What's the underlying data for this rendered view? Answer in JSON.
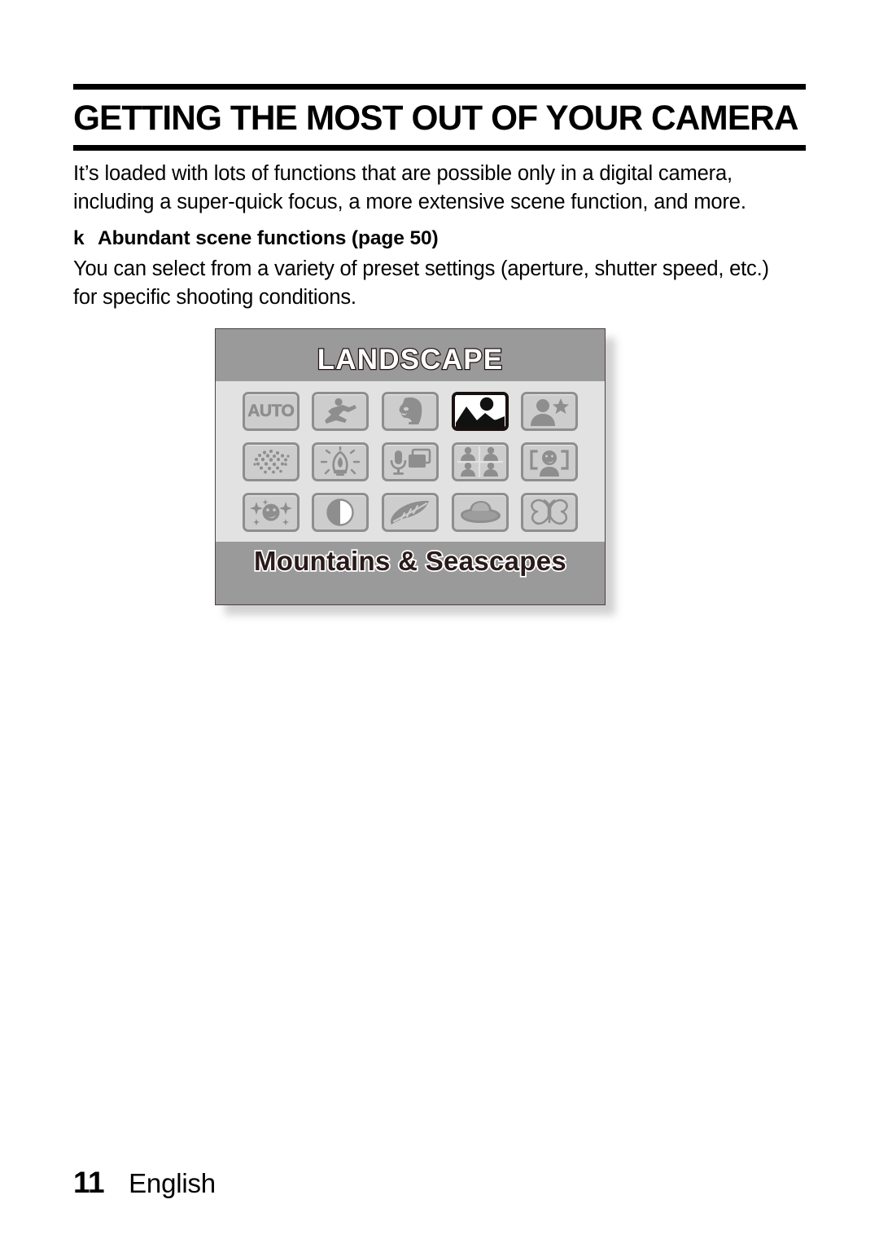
{
  "document": {
    "title": "GETTING THE MOST OUT OF YOUR CAMERA",
    "intro_line_1": "It’s loaded with lots of functions that are possible only in a digital camera,",
    "intro_line_2": "including a super-quick focus, a more extensive scene function, and more.",
    "subhead_bullet": "k",
    "subhead_text": "Abundant scene functions (page 50)",
    "subbody_line_1": "You can select from a variety of preset settings (aperture, shutter speed, etc.)",
    "subbody_line_2": "for specific shooting conditions."
  },
  "figure": {
    "lcd_title": "LANDSCAPE",
    "lcd_caption": "Mountains & Seascapes",
    "auto_label": "AUTO",
    "selected_index": 3,
    "tiles": [
      {
        "name": "auto-mode",
        "label": "AUTO"
      },
      {
        "name": "sports-mode",
        "label": ""
      },
      {
        "name": "portrait-mode",
        "label": ""
      },
      {
        "name": "landscape-mode",
        "label": ""
      },
      {
        "name": "night-portrait-mode",
        "label": ""
      },
      {
        "name": "fireworks-mode",
        "label": ""
      },
      {
        "name": "lamp-mode",
        "label": ""
      },
      {
        "name": "sound-recording-mode",
        "label": ""
      },
      {
        "name": "group-photo-mode",
        "label": ""
      },
      {
        "name": "face-frame-mode",
        "label": ""
      },
      {
        "name": "cosmetic-mode",
        "label": ""
      },
      {
        "name": "monochrome-mode",
        "label": ""
      },
      {
        "name": "leaf-mode",
        "label": ""
      },
      {
        "name": "beach-snow-mode",
        "label": ""
      },
      {
        "name": "close-up-mode",
        "label": ""
      }
    ],
    "colors": {
      "lcd_band": "#9a9a9a",
      "lcd_grid_bg": "#e2e2e2",
      "tile_fill": "#cdcdcd",
      "tile_border": "#8e8e8e",
      "selected_border": "#1a1010",
      "selected_fill": "#ffffff"
    }
  },
  "footer": {
    "page_number": "11",
    "language": "English"
  }
}
